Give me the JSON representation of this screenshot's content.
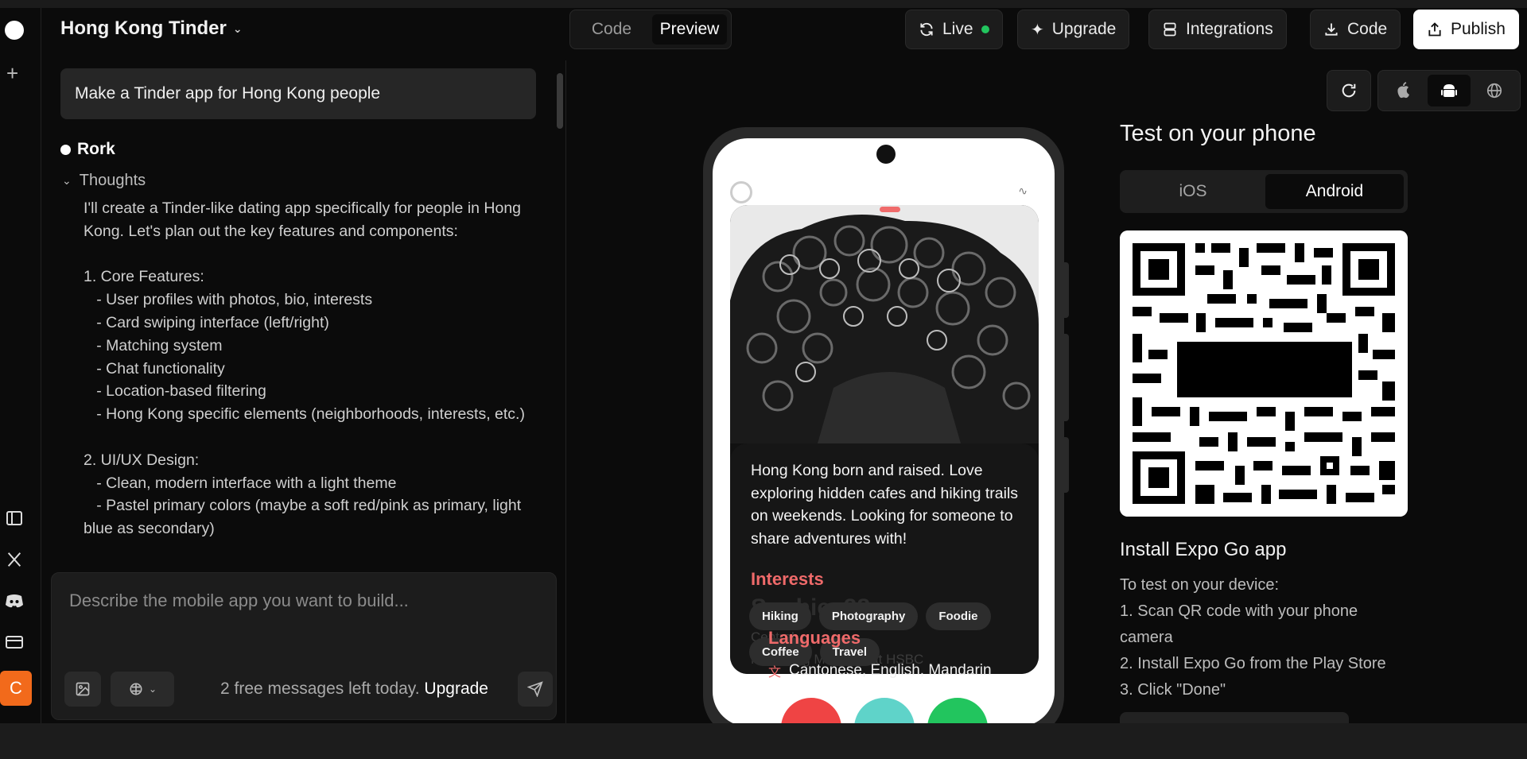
{
  "header": {
    "project_title": "Hong Kong Tinder",
    "view_tabs": [
      "Code",
      "Preview"
    ],
    "active_tab": "Preview",
    "live_label": "Live",
    "upgrade_label": "Upgrade",
    "integrations_label": "Integrations",
    "code_download_label": "Code",
    "publish_label": "Publish"
  },
  "chat": {
    "user_prompt": "Make a Tinder app for Hong Kong people",
    "assistant_name": "Rork",
    "thoughts_label": "Thoughts",
    "thoughts_text": "I'll create a Tinder-like dating app specifically for people in Hong Kong. Let's plan out the key features and components:\n\n1. Core Features:\n   - User profiles with photos, bio, interests\n   - Card swiping interface (left/right)\n   - Matching system\n   - Chat functionality\n   - Location-based filtering\n   - Hong Kong specific elements (neighborhoods, interests, etc.)\n\n2. UI/UX Design:\n   - Clean, modern interface with a light theme\n   - Pastel primary colors (maybe a soft red/pink as primary, light blue as secondary)",
    "composer_placeholder": "Describe the mobile app you want to build...",
    "limit_text": "2 free messages left today.",
    "limit_upgrade": "Upgrade"
  },
  "phone": {
    "bio": "Hong Kong born and raised. Love exploring hidden cafes and hiking trails on weekends. Looking for someone to share adventures with!",
    "ghost_name": "Sophie, 28",
    "ghost_location": "Central",
    "ghost_job": "Marketing Manager at HSBC",
    "interests_title": "Interests",
    "interests": [
      "Hiking",
      "Photography",
      "Foodie",
      "Coffee",
      "Travel"
    ],
    "languages_title": "Languages",
    "languages": "Cantonese, English, Mandarin"
  },
  "test_panel": {
    "title": "Test on your phone",
    "os_options": [
      "iOS",
      "Android"
    ],
    "active_os": "Android",
    "install_title": "Install Expo Go app",
    "steps_intro": "To test on your device:",
    "step1": "1. Scan QR code with your phone camera",
    "step2": "2. Install Expo Go from the Play Store",
    "step3": "3. Click \"Done\""
  },
  "colors": {
    "accent_red": "#ef6a6a",
    "live_green": "#22c55e",
    "avatar_orange": "#f26a1b"
  }
}
